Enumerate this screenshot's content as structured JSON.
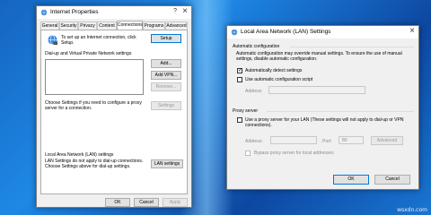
{
  "internet_properties": {
    "title": "Internet Properties",
    "help": "?",
    "close": "×",
    "tabs": [
      "General",
      "Security",
      "Privacy",
      "Content",
      "Connections",
      "Programs",
      "Advanced"
    ],
    "active_tab": "Connections",
    "setup_text": "To set up an Internet connection, click Setup.",
    "setup_button": "Setup",
    "dialup_heading": "Dial-up and Virtual Private Network settings",
    "add_button": "Add...",
    "add_vpn_button": "Add VPN...",
    "remove_button": "Remove...",
    "choose_settings_text": "Choose Settings if you need to configure a proxy server for a connection.",
    "settings_button": "Settings",
    "lan_heading": "Local Area Network (LAN) settings",
    "lan_text": "LAN Settings do not apply to dial-up connections. Choose Settings above for dial-up settings.",
    "lan_settings_button": "LAN settings",
    "ok_button": "OK",
    "cancel_button": "Cancel",
    "apply_button": "Apply"
  },
  "lan_settings": {
    "title": "Local Area Network (LAN) Settings",
    "close": "×",
    "auto_config_heading": "Automatic configuration",
    "auto_config_text": "Automatic configuration may override manual settings. To ensure the use of manual settings, disable automatic configuration.",
    "auto_detect_label": "Automatically detect settings",
    "auto_detect_checked": true,
    "use_script_label": "Use automatic configuration script",
    "use_script_checked": false,
    "address_label": "Address",
    "proxy_heading": "Proxy server",
    "use_proxy_label": "Use a proxy server for your LAN (These settings will not apply to dial-up or VPN connections).",
    "use_proxy_checked": false,
    "proxy_address_label": "Address:",
    "port_label": "Port:",
    "port_value": "80",
    "advanced_button": "Advanced",
    "bypass_label": "Bypass proxy server for local addresses",
    "bypass_checked": false,
    "ok_button": "OK",
    "cancel_button": "Cancel"
  },
  "watermark": "wsxdn.com"
}
